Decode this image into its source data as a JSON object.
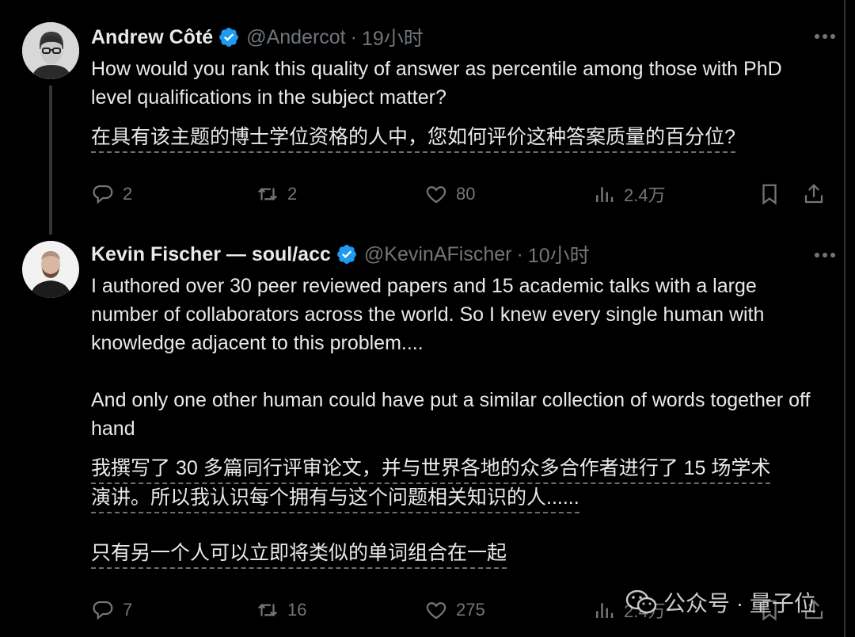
{
  "tweets": [
    {
      "author_name": "Andrew Côté",
      "handle": "@Andercot",
      "separator": "·",
      "time": "19小时",
      "text": "How would you rank this quality of answer as percentile among those with PhD level qualifications in the subject matter?",
      "translation_lines": [
        "在具有该主题的博士学位资格的人中，您如何评价这种答案质量的百分位?"
      ],
      "replies": "2",
      "retweets": "2",
      "likes": "80",
      "views": "2.4万"
    },
    {
      "author_name": "Kevin Fischer — soul/acc",
      "handle": "@KevinAFischer",
      "separator": "·",
      "time": "10小时",
      "text": "I authored over 30 peer reviewed papers and 15 academic talks with a large number of collaborators across the world. So I knew every single human with knowledge adjacent to this problem....\n\nAnd only one other human could have put a similar collection of words together off hand",
      "translation_lines": [
        "我撰写了 30 多篇同行评审论文，并与世界各地的众多合作者进行了 15 场学术",
        "演讲。所以我认识每个拥有与这个问题相关知识的人......",
        "只有另一个人可以立即将类似的单词组合在一起"
      ],
      "replies": "7",
      "retweets": "16",
      "likes": "275",
      "views": "2.4万"
    }
  ],
  "watermark": {
    "text": "公众号 · 量子位"
  },
  "colors": {
    "background": "#000000",
    "text": "#e7e9ea",
    "muted": "#71767b",
    "verified": "#1d9bf0"
  }
}
